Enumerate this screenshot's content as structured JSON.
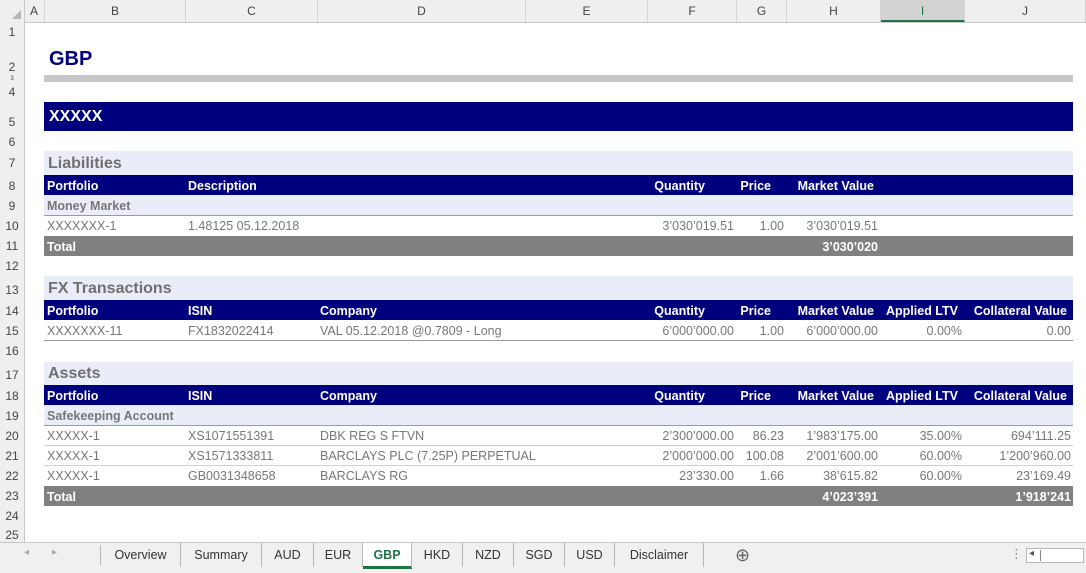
{
  "columns": [
    "A",
    "B",
    "C",
    "D",
    "E",
    "F",
    "G",
    "H",
    "I",
    "J"
  ],
  "rows": [
    "1",
    "2",
    "3",
    "4",
    "5",
    "6",
    "7",
    "8",
    "9",
    "10",
    "11",
    "12",
    "13",
    "14",
    "15",
    "16",
    "17",
    "18",
    "19",
    "20",
    "21",
    "22",
    "23",
    "24",
    "25"
  ],
  "sheet": {
    "title": "GBP",
    "client": "XXXXX",
    "liabilities": {
      "section": "Liabilities",
      "headers": {
        "portfolio": "Portfolio",
        "description": "Description",
        "quantity": "Quantity",
        "price": "Price",
        "market_value": "Market Value"
      },
      "group": "Money Market",
      "row": {
        "portfolio": "XXXXXXX-1",
        "description": "1.48125 05.12.2018",
        "quantity": "3’030’019.51",
        "price": "1.00",
        "market_value": "3’030’019.51"
      },
      "total_label": "Total",
      "total_value": "3’030’020"
    },
    "fx": {
      "section": "FX Transactions",
      "headers": {
        "portfolio": "Portfolio",
        "isin": "ISIN",
        "company": "Company",
        "quantity": "Quantity",
        "price": "Price",
        "market_value": "Market Value",
        "ltv": "Applied LTV",
        "collateral": "Collateral Value"
      },
      "row": {
        "portfolio": "XXXXXXX-11",
        "isin": "FX1832022414",
        "company": "VAL 05.12.2018 @0.7809 - Long",
        "quantity": "6’000’000.00",
        "price": "1.00",
        "market_value": "6’000’000.00",
        "ltv": "0.00%",
        "collateral": "0.00"
      }
    },
    "assets": {
      "section": "Assets",
      "headers": {
        "portfolio": "Portfolio",
        "isin": "ISIN",
        "company": "Company",
        "quantity": "Quantity",
        "price": "Price",
        "market_value": "Market Value",
        "ltv": "Applied LTV",
        "collateral": "Collateral Value"
      },
      "group": "Safekeeping Account",
      "rows": [
        {
          "portfolio": "XXXXX-1",
          "isin": "XS1071551391",
          "company": "DBK REG S FTVN",
          "quantity": "2’300’000.00",
          "price": "86.23",
          "market_value": "1’983’175.00",
          "ltv": "35.00%",
          "collateral": "694’111.25"
        },
        {
          "portfolio": "XXXXX-1",
          "isin": "XS1571333811",
          "company": "BARCLAYS PLC (7.25P) PERPETUAL",
          "quantity": "2’000’000.00",
          "price": "100.08",
          "market_value": "2’001’600.00",
          "ltv": "60.00%",
          "collateral": "1’200’960.00"
        },
        {
          "portfolio": "XXXXX-1",
          "isin": "GB0031348658",
          "company": "BARCLAYS RG",
          "quantity": "23’330.00",
          "price": "1.66",
          "market_value": "38’615.82",
          "ltv": "60.00%",
          "collateral": "23’169.49"
        }
      ],
      "total_label": "Total",
      "total_market_value": "4’023’391",
      "total_collateral": "1’918’241"
    }
  },
  "tabs": [
    "Overview",
    "Summary",
    "AUD",
    "EUR",
    "GBP",
    "HKD",
    "NZD",
    "SGD",
    "USD",
    "Disclaimer"
  ],
  "active_tab": "GBP",
  "nav": {
    "prev": "◂",
    "next": "▸",
    "add": "⊕",
    "more": "⋮",
    "scroll_left": "◂"
  },
  "colors": {
    "navy": "#00007f",
    "total_gray": "#808080",
    "light_band": "#e8edf7",
    "excel_green": "#217346"
  }
}
